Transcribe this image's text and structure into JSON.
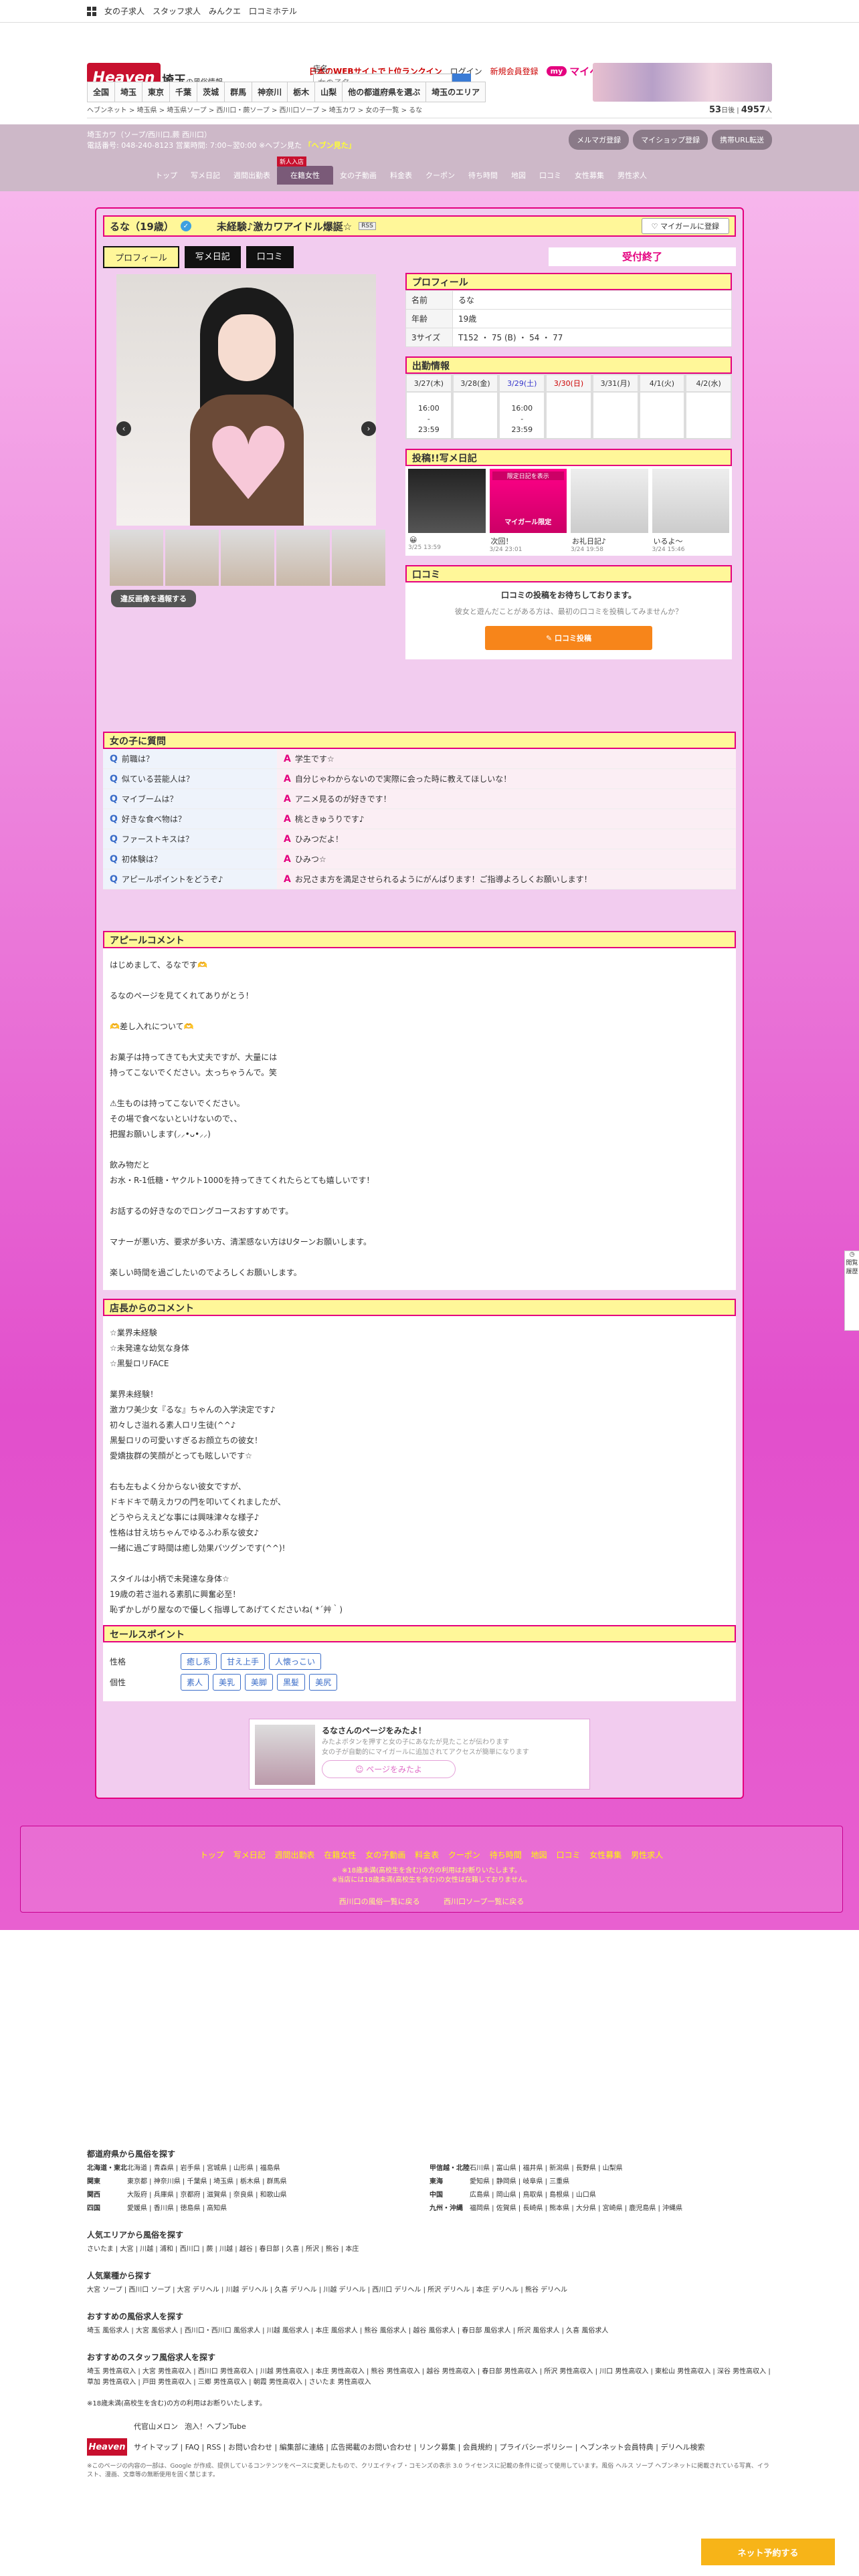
{
  "topbar": {
    "links": [
      "女の子求人",
      "スタッフ求人",
      "みんクエ",
      "口コミホテル"
    ],
    "rank_text": "日本のWEBサイトで上位ランクイン",
    "login": "ログイン",
    "register": "新規会員登録",
    "my_badge": "my",
    "myheaven": "マイヘブン"
  },
  "header": {
    "logo": "Heaven",
    "pref": "埼玉",
    "pref_sub": "の風俗情報",
    "search_label": "店名",
    "search_placeholder": "女の子名",
    "area_tabs": [
      "全国",
      "埼玉",
      "東京",
      "千葉",
      "茨城",
      "群馬",
      "神奈川",
      "栃木",
      "山梨",
      "他の都道府県を選ぶ",
      "埼玉のエリア"
    ],
    "breadcrumb": "ヘブンネット > 埼玉県 > 埼玉県ソープ > 西川口・蕨ソープ > 西川口ソープ > 埼玉カワ > 女の子一覧 > るな",
    "count_a": "53",
    "count_a_unit": "日後",
    "count_b": "4957",
    "count_b_unit": "人"
  },
  "shop": {
    "info1": "埼玉カワ（ソープ/西川口,蕨 西川口）",
    "info2": "電話番号: 048-240-8123 営業時間: 7:00~翌0:00 ※ヘブン見た",
    "hl": "「ヘブン見た」",
    "buttons": [
      "メルマガ登録",
      "マイショップ登録",
      "携帯URL転送"
    ],
    "tabs": [
      "トップ",
      "写メ日記",
      "週間出勤表",
      "在籍女性",
      "女の子動画",
      "料金表",
      "クーポン",
      "待ち時間",
      "地図",
      "口コミ",
      "女性募集",
      "男性求人"
    ],
    "new_badge": "新人入店"
  },
  "profile": {
    "name": "るな（19歳）",
    "catch": "未経験♪激カワアイドル爆誕☆",
    "rss": "RSS",
    "mygirl": "マイガールに登録",
    "subtabs": [
      "プロフィール",
      "写メ日記",
      "口コミ"
    ],
    "status": "受付終了",
    "remove_btn": "違反画像を通報する",
    "section_title": "プロフィール",
    "rows": [
      {
        "k": "名前",
        "v": "るな"
      },
      {
        "k": "年齢",
        "v": "19歳"
      },
      {
        "k": "3サイズ",
        "v": "T152 ・ 75 (B) ・ 54 ・ 77"
      }
    ]
  },
  "schedule": {
    "title": "出勤情報",
    "days": [
      {
        "d": "3/27(木)",
        "t1": "16:00",
        "t2": "-",
        "t3": "23:59",
        "cls": ""
      },
      {
        "d": "3/28(金)",
        "t1": "",
        "t2": "",
        "t3": "",
        "cls": ""
      },
      {
        "d": "3/29(土)",
        "t1": "16:00",
        "t2": "-",
        "t3": "23:59",
        "cls": "sat"
      },
      {
        "d": "3/30(日)",
        "t1": "",
        "t2": "",
        "t3": "",
        "cls": "sun"
      },
      {
        "d": "3/31(月)",
        "t1": "",
        "t2": "",
        "t3": "",
        "cls": ""
      },
      {
        "d": "4/1(火)",
        "t1": "",
        "t2": "",
        "t3": "",
        "cls": ""
      },
      {
        "d": "4/2(水)",
        "t1": "",
        "t2": "",
        "t3": "",
        "cls": ""
      }
    ]
  },
  "diary": {
    "title": "投稿!!写メ日記",
    "items": [
      {
        "cap": "😀",
        "dt": "3/25 13:59"
      },
      {
        "cap": "次回！",
        "dt": "3/24 23:01"
      },
      {
        "cap": "お礼日記♪",
        "dt": "3/24 19:58"
      },
      {
        "cap": "いるよ〜",
        "dt": "3/24 15:46"
      }
    ],
    "limited": "限定日記を表示",
    "mygirl_only": "マイガール限定"
  },
  "review": {
    "title": "口コミ",
    "lead": "口コミの投稿をお待ちしております。",
    "sub": "彼女と遊んだことがある方は、最初の口コミを投稿してみませんか？",
    "btn": "✎ 口コミ投稿"
  },
  "qa": {
    "title": "女の子に質問",
    "items": [
      {
        "q": "前職は？",
        "a": "学生です☆"
      },
      {
        "q": "似ている芸能人は？",
        "a": "自分じゃわからないので実際に会った時に教えてほしいな！"
      },
      {
        "q": "マイブームは？",
        "a": "アニメ見るのが好きです！"
      },
      {
        "q": "好きな食べ物は？",
        "a": "桃ときゅうりです♪"
      },
      {
        "q": "ファーストキスは？",
        "a": "ひみつだよ！"
      },
      {
        "q": "初体験は？",
        "a": "ひみつ☆"
      },
      {
        "q": "アピールポイントをどうぞ♪",
        "a": "お兄さま方を満足させられるようにがんばります！ご指導よろしくお願いします！"
      }
    ]
  },
  "appeal": {
    "title": "アピールコメント",
    "text": "はじめまして、るなです🫶\n\nるなのページを見てくれてありがとう！\n\n🫶差し入れについて🫶\n\nお菓子は持ってきても大丈夫ですが、大量には\n持ってこないでください。太っちゃうんで。笑\n\n⚠生ものは持ってこないでください。\nその場で食べないといけないので、、\n把握お願いします(⸝⸝•ᴗ•⸝⸝)\n\n飲み物だと\nお水・R-1低糖・ヤクルト1000を持ってきてくれたらとても嬉しいです！\n\nお話するの好きなのでロングコースおすすめです。\n\nマナーが悪い方、要求が多い方、清潔感ない方はUターンお願いします。\n\n楽しい時間を過ごしたいのでよろしくお願いします。"
  },
  "manager": {
    "title": "店長からのコメント",
    "text": "☆業界未経験\n☆未発達な幼気な身体\n☆黒髪ロリFACE\n\n業界未経験！\n激カワ美少女『るな』ちゃんの入学決定です♪\n初々しさ溢れる素人ロリ生徒(^^♪\n黒髪ロリの可愛いすぎるお顔立ちの彼女！\n愛嬌抜群の笑顔がとっても眩しいです☆\n\n右も左もよく分からない彼女ですが、\nドキドキで萌えカワの門を叩いてくれましたが、\nどうやらええどな事には興味津々な様子♪\n性格は甘え坊ちゃんでゆるふわ系な彼女♪\n一緒に過ごす時間は癒し効果バツグンです(^^)!\n\nスタイルは小柄で未発達な身体☆\n19歳の若さ溢れる素肌に興奮必至！\n恥ずかしがり屋なので優しく指導してあげてくださいね( *´艸｀)"
  },
  "sales": {
    "title": "セールスポイント",
    "rows": [
      {
        "k": "性格",
        "tags": [
          "癒し系",
          "甘え上手",
          "人懐っこい"
        ]
      },
      {
        "k": "個性",
        "tags": [
          "素人",
          "美乳",
          "美脚",
          "黒髪",
          "美尻"
        ]
      }
    ]
  },
  "promo": {
    "title": "るなさんのページをみたよ！",
    "sub1": "みたよボタンを押すと女の子にあなたが見たことが伝わります",
    "sub2": "女の子が自動的にマイガールに追加されてアクセスが簡単になります",
    "btn": "☺ ページをみたよ"
  },
  "pinkfoot": {
    "nav": [
      "トップ",
      "写メ日記",
      "週間出勤表",
      "在籍女性",
      "女の子動画",
      "料金表",
      "クーポン",
      "待ち時間",
      "地図",
      "口コミ",
      "女性募集",
      "男性求人"
    ],
    "warn1": "※18歳未満(高校生を含む)の方の利用はお断りいたします。",
    "warn2": "※当店には18歳未満(高校生を含む)の女性は在籍しておりません。",
    "back": [
      "西川口の風俗一覧に戻る",
      "西川口ソープ一覧に戻る"
    ]
  },
  "footer": {
    "pref_title": "都道府県から風俗を探す",
    "regions": [
      {
        "r": "北海道・東北",
        "p": "北海道 | 青森県 | 岩手県 | 宮城県 | 山形県 | 福島県"
      },
      {
        "r": "甲信越・北陸",
        "p": "石川県 | 富山県 | 福井県 | 新潟県 | 長野県 | 山梨県"
      },
      {
        "r": "関東",
        "p": "東京都 | 神奈川県 | 千葉県 | 埼玉県 | 栃木県 | 群馬県"
      },
      {
        "r": "東海",
        "p": "愛知県 | 静岡県 | 岐阜県 | 三重県"
      },
      {
        "r": "関西",
        "p": "大阪府 | 兵庫県 | 京都府 | 滋賀県 | 奈良県 | 和歌山県"
      },
      {
        "r": "中国",
        "p": "広島県 | 岡山県 | 鳥取県 | 島根県 | 山口県"
      },
      {
        "r": "四国",
        "p": "愛媛県 | 香川県 | 徳島県 | 高知県"
      },
      {
        "r": "九州・沖縄",
        "p": "福岡県 | 佐賀県 | 長崎県 | 熊本県 | 大分県 | 宮崎県 | 鹿児島県 | 沖縄県"
      }
    ],
    "pop_area_title": "人気エリアから風俗を探す",
    "pop_area": "さいたま | 大宮 | 川越 | 浦和 | 西川口 | 蕨 | 川越 | 越谷 | 春日部 | 久喜 | 所沢 | 熊谷 | 本庄",
    "pop_genre_title": "人気業種から探す",
    "pop_genre": "大宮 ソープ | 西川口 ソープ | 大宮 デリヘル | 川越 デリヘル | 久喜 デリヘル | 川越 デリヘル | 西川口 デリヘル | 所沢 デリヘル | 本庄 デリヘル | 熊谷 デリヘル",
    "job_title": "おすすめの風俗求人を探す",
    "job": "埼玉 風俗求人 | 大宮 風俗求人 | 西川口・西川口 風俗求人 | 川越 風俗求人 | 本庄 風俗求人 | 熊谷 風俗求人 | 越谷 風俗求人 | 春日部 風俗求人 | 所沢 風俗求人 | 久喜 風俗求人",
    "staff_title": "おすすめのスタッフ風俗求人を探す",
    "staff": "埼玉 男性高収入 | 大宮 男性高収入 | 西川口 男性高収入 | 川越 男性高収入 | 本庄 男性高収入 | 熊谷 男性高収入 | 越谷 男性高収入 | 春日部 男性高収入 | 所沢 男性高収入 | 川口 男性高収入 | 東松山 男性高収入 | 深谷 男性高収入 | 草加 男性高収入 | 戸田 男性高収入 | 三郷 男性高収入 | 朝霞 男性高収入 | さいたま 男性高収入",
    "note": "※18歳未満(高校生を含む)の方の利用はお断りいたします。",
    "partners": [
      "代官山メロン",
      "泡入！ヘブンTube"
    ],
    "sitemap": "サイトマップ | FAQ | RSS | お問い合わせ | 編集部に連絡 | 広告掲載のお問い合わせ | リンク募集 | 会員規約 | プライバシーポリシー | ヘブンネット会員特典 | デリヘル検索",
    "copy": "※このページの内容の一部は、Google が作成、提供しているコンテンツをベースに変更したもので、クリエイティブ・コモンズの表示 3.0 ライセンスに記載の条件に従って使用しています。風俗 ヘルス ソープ ヘブンネットに掲載されている写真、イラスト、漫画、文章等の無断使用を固く禁じます。"
  },
  "reserve": "ネット予約する",
  "side": "閲覧履歴"
}
